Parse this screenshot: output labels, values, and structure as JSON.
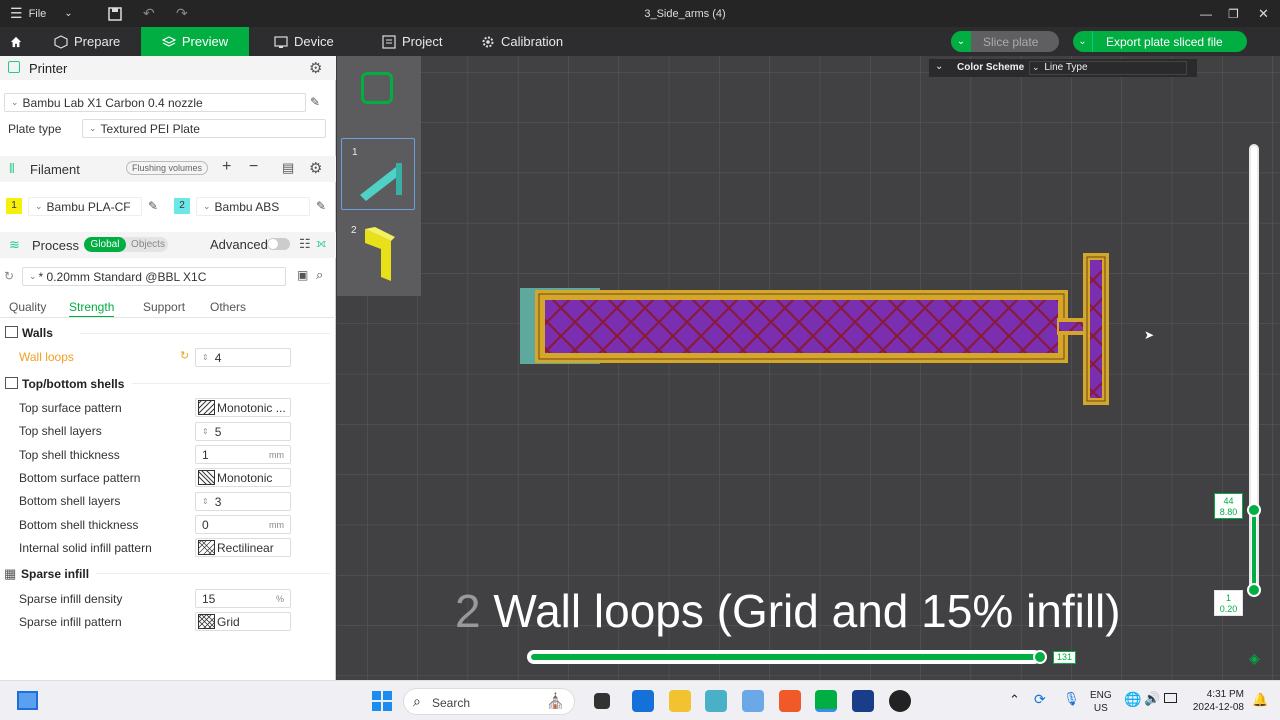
{
  "titlebar": {
    "menu_label": "File",
    "doc_title": "3_Side_arms (4)"
  },
  "nav": {
    "tabs": [
      {
        "label": "Prepare"
      },
      {
        "label": "Preview"
      },
      {
        "label": "Device"
      },
      {
        "label": "Project"
      },
      {
        "label": "Calibration"
      }
    ],
    "slice_label": "Slice plate",
    "export_label": "Export plate sliced file"
  },
  "printer": {
    "section_label": "Printer",
    "printer_name": "Bambu Lab X1 Carbon 0.4 nozzle",
    "plate_type_label": "Plate type",
    "plate_type_value": "Textured PEI Plate"
  },
  "filament": {
    "section_label": "Filament",
    "flushing_label": "Flushing volumes",
    "items": [
      {
        "index": "1",
        "name": "Bambu PLA-CF",
        "color": "#f5ef0a"
      },
      {
        "index": "2",
        "name": "Bambu ABS",
        "color": "#6ce6e6"
      }
    ]
  },
  "process": {
    "section_label": "Process",
    "global_label": "Global",
    "objects_label": "Objects",
    "advanced_label": "Advanced",
    "preset": "* 0.20mm Standard @BBL X1C",
    "tabs": [
      "Quality",
      "Strength",
      "Support",
      "Others"
    ],
    "active_tab": "Strength"
  },
  "settings": {
    "walls_header": "Walls",
    "wall_loops_label": "Wall loops",
    "wall_loops_value": "4",
    "topbottom_header": "Top/bottom shells",
    "top_surface_pattern_label": "Top surface pattern",
    "top_surface_pattern_value": "Monotonic ...",
    "top_shell_layers_label": "Top shell layers",
    "top_shell_layers_value": "5",
    "top_shell_thickness_label": "Top shell thickness",
    "top_shell_thickness_value": "1",
    "bottom_surface_pattern_label": "Bottom surface pattern",
    "bottom_surface_pattern_value": "Monotonic",
    "bottom_shell_layers_label": "Bottom shell layers",
    "bottom_shell_layers_value": "3",
    "bottom_shell_thickness_label": "Bottom shell thickness",
    "bottom_shell_thickness_value": "0",
    "internal_solid_label": "Internal solid infill pattern",
    "internal_solid_value": "Rectilinear",
    "sparse_header": "Sparse infill",
    "sparse_density_label": "Sparse infill density",
    "sparse_density_value": "15",
    "sparse_pattern_label": "Sparse infill pattern",
    "sparse_pattern_value": "Grid",
    "unit_mm": "mm",
    "unit_pct": "%"
  },
  "viewport": {
    "color_scheme_label": "Color Scheme",
    "color_scheme_value": "Line Type",
    "plates": [
      {
        "num": "1"
      },
      {
        "num": "2"
      }
    ],
    "caption_ghost": "2",
    "caption": "Wall loops (Grid and 15% infill)",
    "layer_top_a": "44",
    "layer_top_b": "8.80",
    "layer_bottom_a": "1",
    "layer_bottom_b": "0.20",
    "move_slider_value": "131",
    "layer_progress": 0.16,
    "move_progress": 1.0,
    "colors": {
      "infill": "#7a2fb0",
      "wall": "#d4a62a",
      "accent": "#00ae42"
    }
  },
  "taskbar": {
    "search_placeholder": "Search",
    "lang_a": "ENG",
    "lang_b": "US",
    "time": "4:31 PM",
    "date": "2024-12-08"
  }
}
